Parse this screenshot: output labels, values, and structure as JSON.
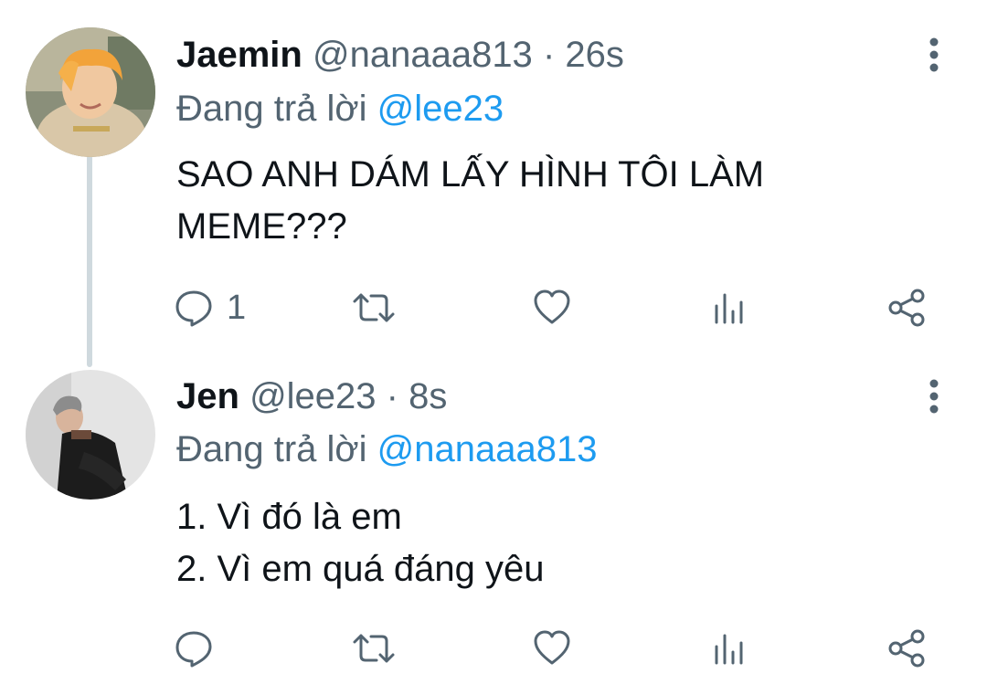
{
  "tweets": [
    {
      "name": "Jaemin",
      "handle": "@nanaaa813",
      "separator": "·",
      "time": "26s",
      "replying_prefix": "Đang trả lời",
      "replying_to": "@lee23",
      "text_lines": [
        "SAO ANH DÁM LẤY HÌNH TÔI LÀM",
        "MEME???"
      ],
      "reply_count": "1",
      "avatar_icon": "avatar-photo-orange-hair"
    },
    {
      "name": "Jen",
      "handle": "@lee23",
      "separator": "·",
      "time": "8s",
      "replying_prefix": "Đang trả lời",
      "replying_to": "@nanaaa813",
      "text_lines": [
        "1. Vì đó là em",
        "2. Vì em quá đáng yêu"
      ],
      "reply_count": "",
      "avatar_icon": "avatar-photo-dark-outfit"
    }
  ],
  "icons": {
    "reply": "speech-bubble-icon",
    "retweet": "retweet-icon",
    "like": "heart-icon",
    "stats": "bar-chart-icon",
    "share": "share-icon",
    "more": "vertical-ellipsis-icon"
  },
  "colors": {
    "text": "#0f1419",
    "secondary": "#536471",
    "link": "#1d9bf0",
    "thread_line": "#cfd9de"
  }
}
